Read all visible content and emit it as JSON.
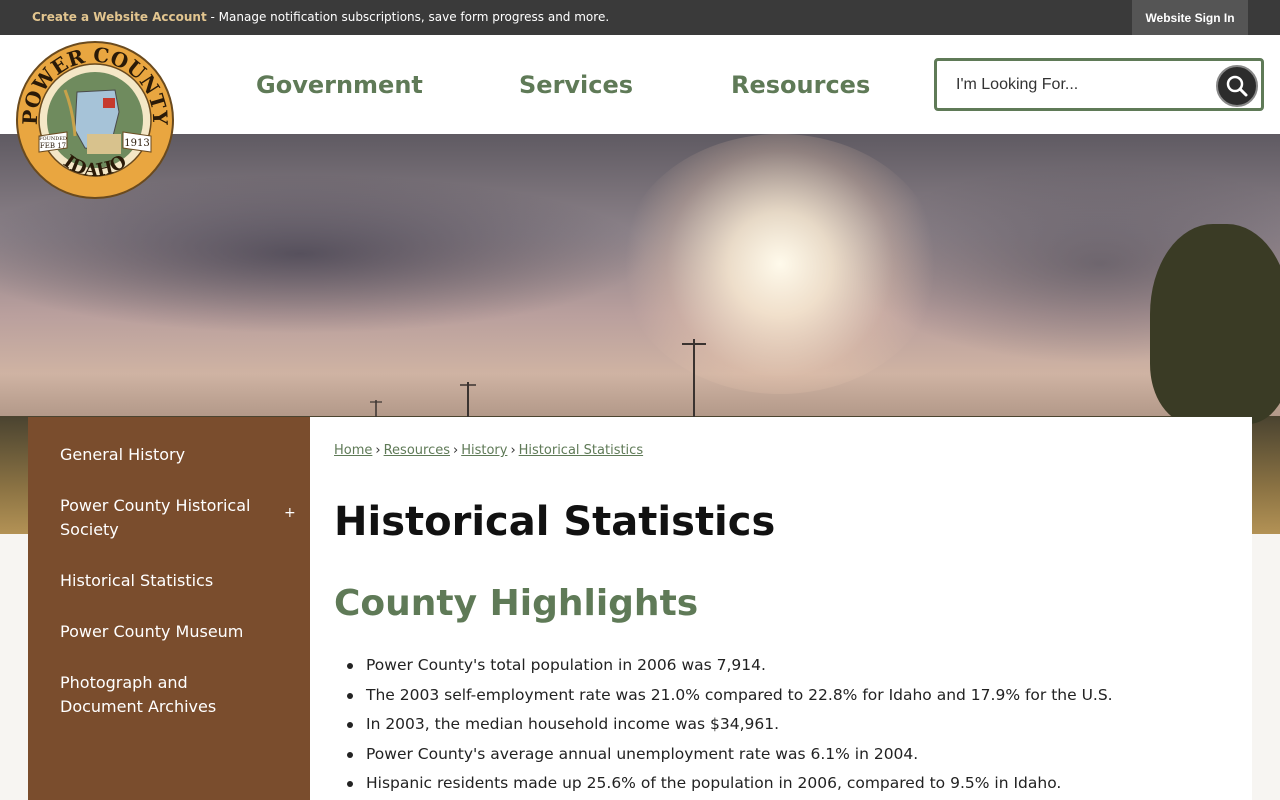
{
  "topbar": {
    "account_link": "Create a Website Account",
    "account_message": " - Manage notification subscriptions, save form progress and more.",
    "sign_in": "Website Sign In"
  },
  "logo": {
    "top_text": "POWER COUNTY",
    "bottom_text": "IDAHO",
    "founded_label": "FOUNDED",
    "founded_date": "FEB 17",
    "founded_year": "1913"
  },
  "nav": {
    "items": [
      "Government",
      "Services",
      "Resources"
    ]
  },
  "search": {
    "placeholder": "I'm Looking For..."
  },
  "sidebar": {
    "items": [
      {
        "label": "General History"
      },
      {
        "label": "Power County Historical Society"
      },
      {
        "label": "Historical Statistics"
      },
      {
        "label": "Power County Museum"
      },
      {
        "label": "Photograph and Document Archives"
      }
    ],
    "expand_symbol": "+"
  },
  "breadcrumb": {
    "items": [
      "Home",
      "Resources",
      "History",
      "Historical Statistics"
    ],
    "separator": "›"
  },
  "main": {
    "title": "Historical Statistics",
    "section_title": "County Highlights",
    "bullets": [
      "Power County's total population in 2006 was 7,914.",
      "The 2003 self-employment rate was 21.0% compared to 22.8% for Idaho and 17.9% for the U.S.",
      "In 2003, the median household income was $34,961.",
      "Power County's average annual unemployment rate was 6.1% in 2004.",
      "Hispanic residents made up 25.6% of the population in 2006, compared to 9.5% in Idaho."
    ]
  },
  "colors": {
    "brand_green": "#5f7a57",
    "sidebar_brown": "#7a4d2d",
    "topbar_dark": "#3a3a3a",
    "account_gold": "#e2c58f"
  }
}
